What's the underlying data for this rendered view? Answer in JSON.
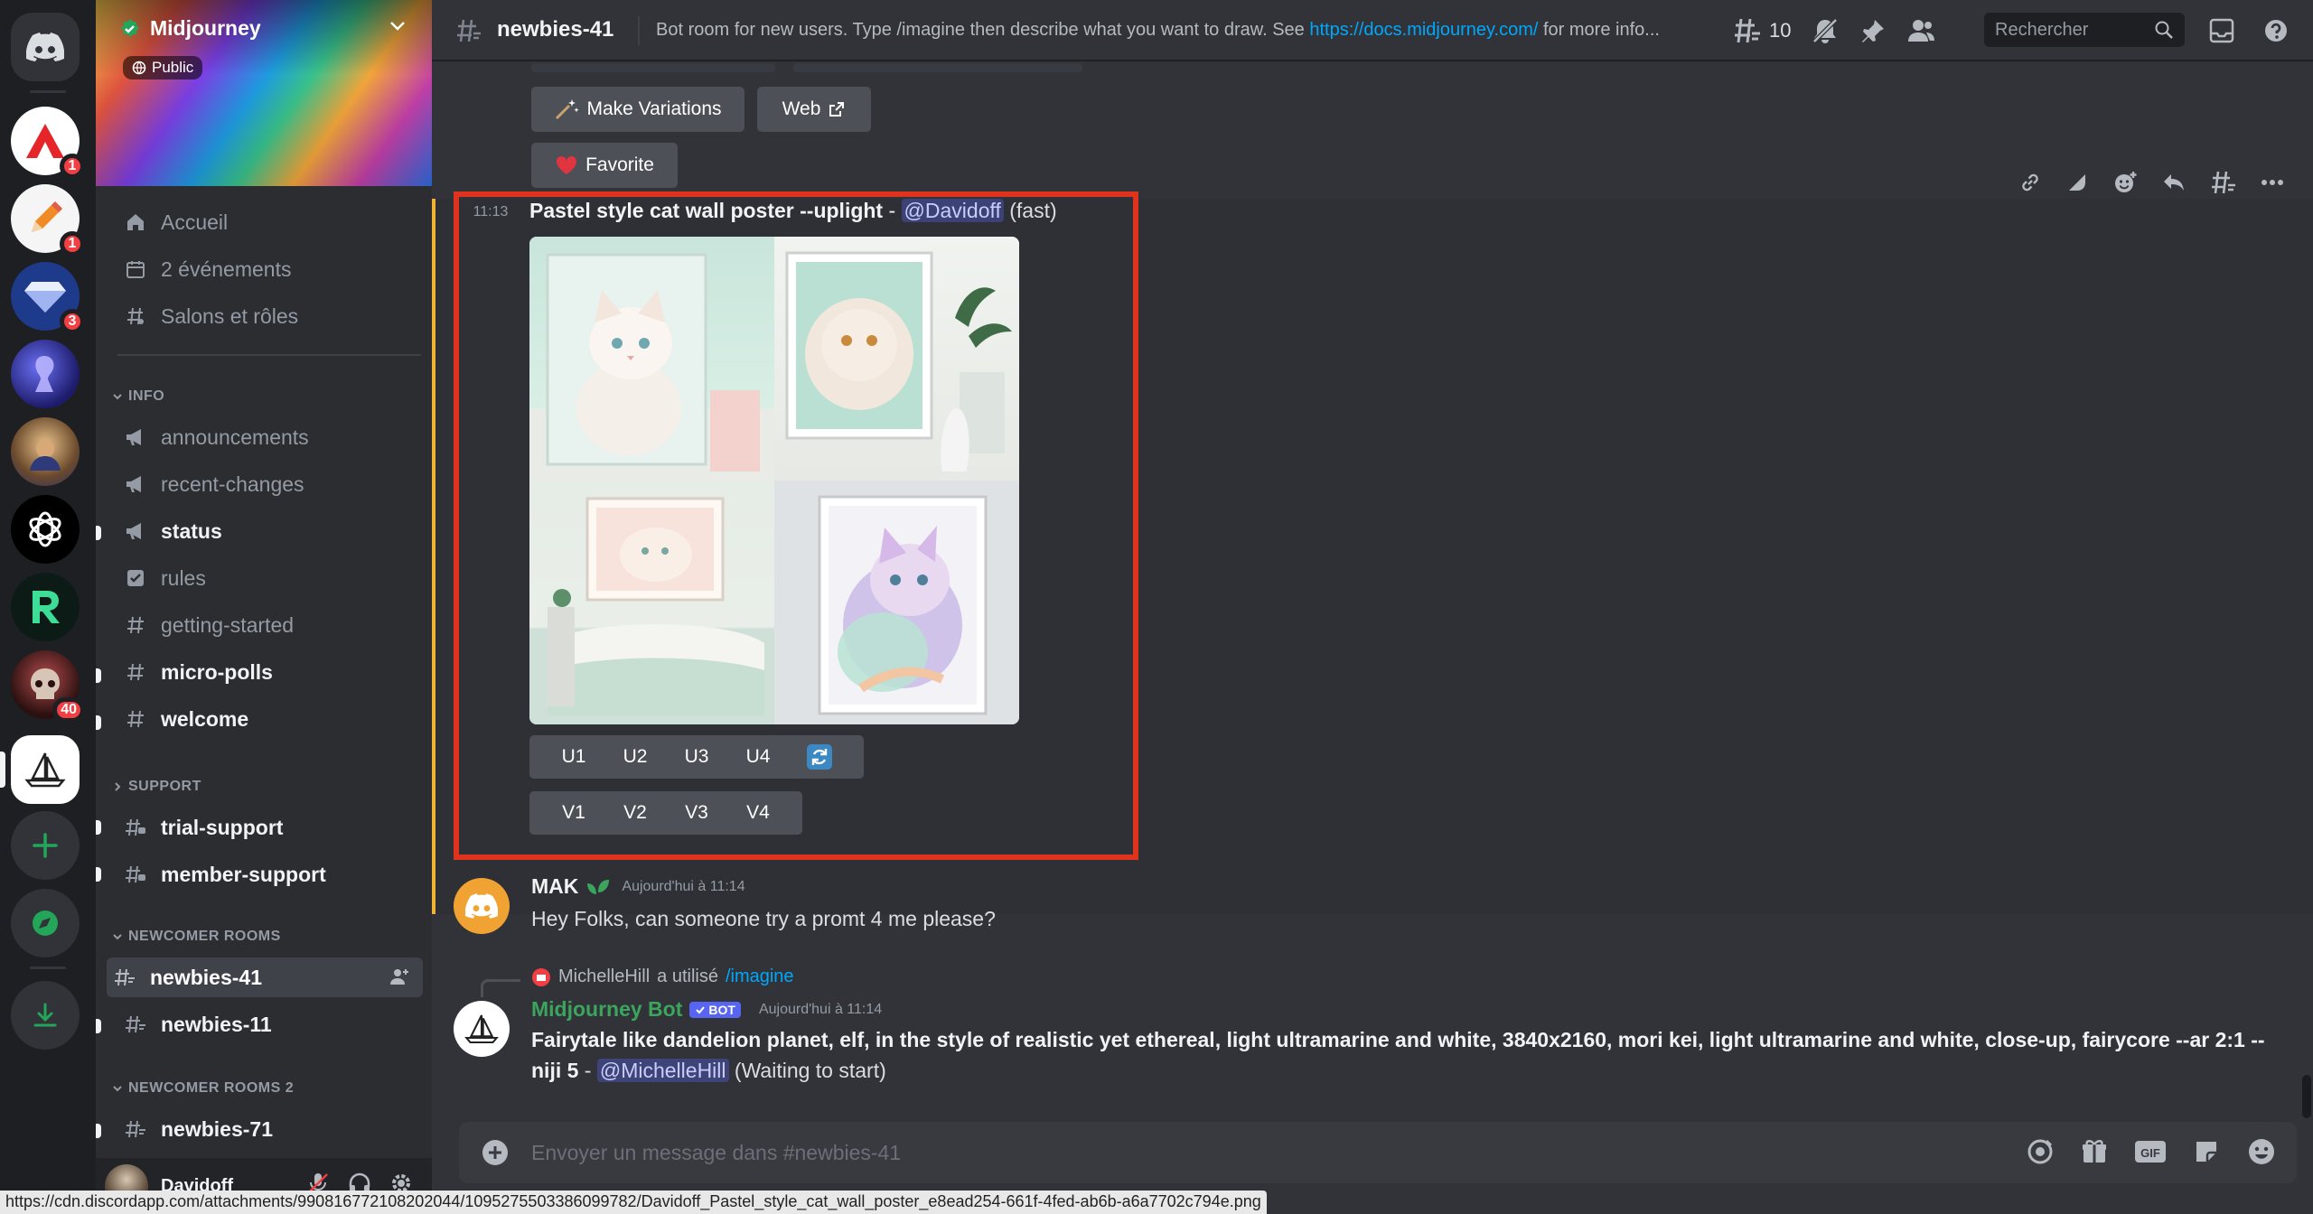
{
  "server": {
    "name": "Midjourney",
    "visibility": "Public",
    "colors": {
      "accent": "#5865f2",
      "highlight_border": "#e0331e",
      "unread_badge": "#f23f43"
    }
  },
  "rail": {
    "servers": [
      {
        "name": "server-a",
        "badge": "1"
      },
      {
        "name": "server-pencil",
        "badge": "1"
      },
      {
        "name": "server-gem",
        "badge": "3"
      },
      {
        "name": "server-purple",
        "badge": ""
      },
      {
        "name": "server-portrait",
        "badge": ""
      },
      {
        "name": "server-openai",
        "badge": ""
      },
      {
        "name": "server-r",
        "badge": ""
      },
      {
        "name": "server-skull",
        "badge": "40"
      },
      {
        "name": "server-midjourney",
        "badge": ""
      }
    ]
  },
  "sidebar": {
    "top": [
      {
        "label": "Accueil",
        "icon": "home-icon"
      },
      {
        "label": "2 événements",
        "icon": "calendar-icon"
      },
      {
        "label": "Salons et rôles",
        "icon": "channels-roles-icon"
      }
    ],
    "categories": {
      "info": "INFO",
      "support": "SUPPORT",
      "newcomer": "NEWCOMER ROOMS",
      "newcomer2": "NEWCOMER ROOMS 2"
    },
    "channels": {
      "announcements": "announcements",
      "recent_changes": "recent-changes",
      "status": "status",
      "rules": "rules",
      "getting_started": "getting-started",
      "micro_polls": "micro-polls",
      "welcome": "welcome",
      "trial_support": "trial-support",
      "member_support": "member-support",
      "newbies_41": "newbies-41",
      "newbies_11": "newbies-11",
      "newbies_71": "newbies-71"
    }
  },
  "user": {
    "name": "Davidoff"
  },
  "header": {
    "channel": "newbies-41",
    "topic_text": "Bot room for new users. Type /imagine then describe what you want to draw. See",
    "topic_link": "https://docs.midjourney.com/",
    "topic_suffix": "for more info...",
    "threads_count": "10",
    "search_placeholder": "Rechercher"
  },
  "messages": {
    "prev_buttons": {
      "variations": "Make Variations",
      "web": "Web",
      "favorite": "Favorite"
    },
    "highlight": {
      "time": "11:13",
      "prompt": "Pastel style cat wall poster --uplight",
      "separator": "-",
      "mention": "@Davidoff",
      "mode": "(fast)",
      "upscale": [
        "U1",
        "U2",
        "U3",
        "U4"
      ],
      "variation": [
        "V1",
        "V2",
        "V3",
        "V4"
      ]
    },
    "mak": {
      "author": "MAK",
      "timestamp": "Aujourd'hui à 11:14",
      "text": "Hey Folks, can someone try a promt 4 me please?"
    },
    "bot": {
      "reply_user": "MichelleHill",
      "reply_used": "a utilisé",
      "reply_command": "/imagine",
      "author": "Midjourney Bot",
      "tag": "BOT",
      "timestamp": "Aujourd'hui à 11:14",
      "prompt_line1": "Fairytale like dandelion planet, elf, in the style of realistic yet ethereal, light ultramarine and white, 3840x2160, mori kei, light ultramarine and white, close-up, fairycore --ar 2:1 --",
      "prompt_line2": "niji 5",
      "separator": "-",
      "mention": "@MichelleHill",
      "status": "(Waiting to start)"
    }
  },
  "composer": {
    "placeholder": "Envoyer un message dans #newbies-41"
  },
  "statusbar": {
    "url": "https://cdn.discordapp.com/attachments/990816772108202044/1095275503386099782/Davidoff_Pastel_style_cat_wall_poster_e8ead254-661f-4fed-ab6b-a6a7702c794e.png"
  }
}
